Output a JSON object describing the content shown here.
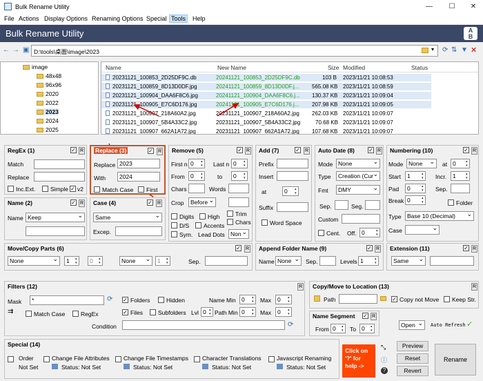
{
  "window": {
    "title": "Bulk Rename Utility"
  },
  "menu": [
    "File",
    "Actions",
    "Display Options",
    "Renaming Options",
    "Special",
    "Tools",
    "Help"
  ],
  "banner": {
    "title": "Bulk Rename Utility",
    "badge_a": "A",
    "badge_b": "B"
  },
  "path": {
    "value": "D:\\tools\\桌面\\image\\2023"
  },
  "tree": {
    "root": "image",
    "items": [
      "48x48",
      "96x96",
      "2020",
      "2022",
      "2023",
      "2024",
      "2025"
    ]
  },
  "files": {
    "headers": {
      "name": "Name",
      "new_name": "New Name",
      "size": "Size",
      "modified": "Modified",
      "status": "Status"
    },
    "rows": [
      {
        "name": "20231121_100853_2D25DF9C.db",
        "new_name": "20241121_100853_2D25DF9C.db",
        "size": "103 B",
        "modified": "2023/11/21 10:08:53",
        "sel": true
      },
      {
        "name": "20231121_100859_8D13D0DF.jpg",
        "new_name": "20241121_100859_8D13D0DF.j...",
        "size": "565.08 KB",
        "modified": "2023/11/21 10:08:59",
        "sel": true
      },
      {
        "name": "20231121_100904_DAA6F8C6.jpg",
        "new_name": "20241121_100904_DAA6F8C6.j...",
        "size": "130.37 KB",
        "modified": "2023/11/21 10:09:04",
        "sel": true
      },
      {
        "name": "20231121_100905_E7C6D176.jpg",
        "new_name": "20241121_100905_E7C6D176.j...",
        "size": "207.98 KB",
        "modified": "2023/11/21 10:09:05",
        "sel": true
      },
      {
        "name": "20231121_100907_218A60A2.jpg",
        "new_name": "20231121_100907_218A60A2.jpg",
        "size": "262.03 KB",
        "modified": "2023/11/21 10:09:07",
        "sel": false
      },
      {
        "name": "20231121_100907_5B4A33C2.jpg",
        "new_name": "20231121_100907_5B4A33C2.jpg",
        "size": "70.68 KB",
        "modified": "2023/11/21 10:09:07",
        "sel": false
      },
      {
        "name": "20231121_100907_662A1A72.jpg",
        "new_name": "20231121_100907_662A1A72.jpg",
        "size": "107.68 KB",
        "modified": "2023/11/21 10:09:07",
        "sel": false
      }
    ]
  },
  "regex": {
    "title": "RegEx (1)",
    "match_label": "Match",
    "replace_label": "Replace",
    "incext": "Inc.Ext.",
    "simple": "Simple",
    "v2": "v2"
  },
  "replace": {
    "title": "Replace (3)",
    "replace_label": "Replace",
    "replace_value": "2023",
    "with_label": "With",
    "with_value": "2024",
    "matchcase": "Match Case",
    "first": "First"
  },
  "remove": {
    "title": "Remove (5)",
    "firstn": "First n",
    "firstn_val": "0",
    "lastn": "Last n",
    "lastn_val": "0",
    "from": "From",
    "from_val": "0",
    "to": "to",
    "to_val": "0",
    "chars": "Chars",
    "words": "Words",
    "crop": "Crop",
    "crop_val": "Before",
    "trim": "Trim",
    "digits": "Digits",
    "high": "High",
    "chars2": "Chars",
    "ds": "D/S",
    "accents": "Accents",
    "sym": "Sym.",
    "leaddots": "Lead Dots",
    "leaddots_val": "Non"
  },
  "add": {
    "title": "Add (7)",
    "prefix": "Prefix",
    "insert": "Insert",
    "at": "at",
    "at_val": "0",
    "suffix": "Suffix",
    "wordspace": "Word Space"
  },
  "autodate": {
    "title": "Auto Date (8)",
    "mode": "Mode",
    "mode_val": "None",
    "type": "Type",
    "type_val": "Creation (Cur",
    "fmt": "Fmt",
    "fmt_val": "DMY",
    "sep": "Sep.",
    "seg": "Seg.",
    "custom": "Custom",
    "cent": "Cent.",
    "off": "Off.",
    "off_val": "0"
  },
  "numbering": {
    "title": "Numbering (10)",
    "mode": "Mode",
    "mode_val": "None",
    "at": "at",
    "at_val": "0",
    "start": "Start",
    "start_val": "1",
    "incr": "Incr.",
    "incr_val": "1",
    "pad": "Pad",
    "pad_val": "0",
    "sep": "Sep.",
    "break": "Break",
    "break_val": "0",
    "folder": "Folder",
    "type": "Type",
    "type_val": "Base 10 (Decimal)",
    "case": "Case"
  },
  "name": {
    "title": "Name (2)",
    "name_label": "Name",
    "name_val": "Keep"
  },
  "casep": {
    "title": "Case (4)",
    "case_val": "Same",
    "excep": "Excep."
  },
  "move": {
    "title": "Move/Copy Parts (6)",
    "dd1": "None",
    "sp1": "1",
    "sp2": "0",
    "dd2": "None",
    "sp3": "1",
    "sep": "Sep."
  },
  "appendfolder": {
    "title": "Append Folder Name (9)",
    "name": "Name",
    "name_val": "None",
    "sep": "Sep.",
    "levels": "Levels",
    "levels_val": "1"
  },
  "extension": {
    "title": "Extension (11)",
    "val": "Same"
  },
  "filters": {
    "title": "Filters (12)",
    "mask": "Mask",
    "mask_val": "*",
    "folders": "Folders",
    "hidden": "Hidden",
    "namemin": "Name Min",
    "namemin_val": "0",
    "max": "Max",
    "max_val": "0",
    "matchcase": "Match Case",
    "regex": "RegEx",
    "files": "Files",
    "subfolders": "Subfolders",
    "lvl": "Lvl",
    "lvl_val": "0",
    "pathmin": "Path Min",
    "pathmin_val": "0",
    "max2": "Max",
    "max2_val": "0",
    "condition": "Condition"
  },
  "copymove": {
    "title": "Copy/Move to Location (13)",
    "path": "Path",
    "copynotmove": "Copy not Move",
    "keepstr": "Keep Str."
  },
  "namesegment": {
    "title": "Name Segment",
    "from": "From",
    "from_val": "0",
    "to": "To",
    "to_val": "0"
  },
  "openauto": {
    "open": "Open",
    "autorefresh": "Auto Refresh"
  },
  "special": {
    "title": "Special (14)",
    "items": [
      {
        "label": "Order",
        "status": "Not Set"
      },
      {
        "label": "Change File Attributes",
        "status": "Status: Not Set"
      },
      {
        "label": "Change File Timestamps",
        "status": "Status: Not Set"
      },
      {
        "label": "Character Translations",
        "status": "Status: Not Set"
      },
      {
        "label": "Javascript Renaming",
        "status": "Status: Not Set"
      }
    ]
  },
  "help": {
    "text": "Click on '?' for help ->"
  },
  "buttons": {
    "preview": "Preview",
    "reset": "Reset",
    "revert": "Revert",
    "rename": "Rename"
  },
  "colors": {
    "banner": "#3a4766",
    "highlight_red": "#d40000",
    "new_name_green": "#1f9a1f",
    "help_orange": "#ff4500"
  }
}
